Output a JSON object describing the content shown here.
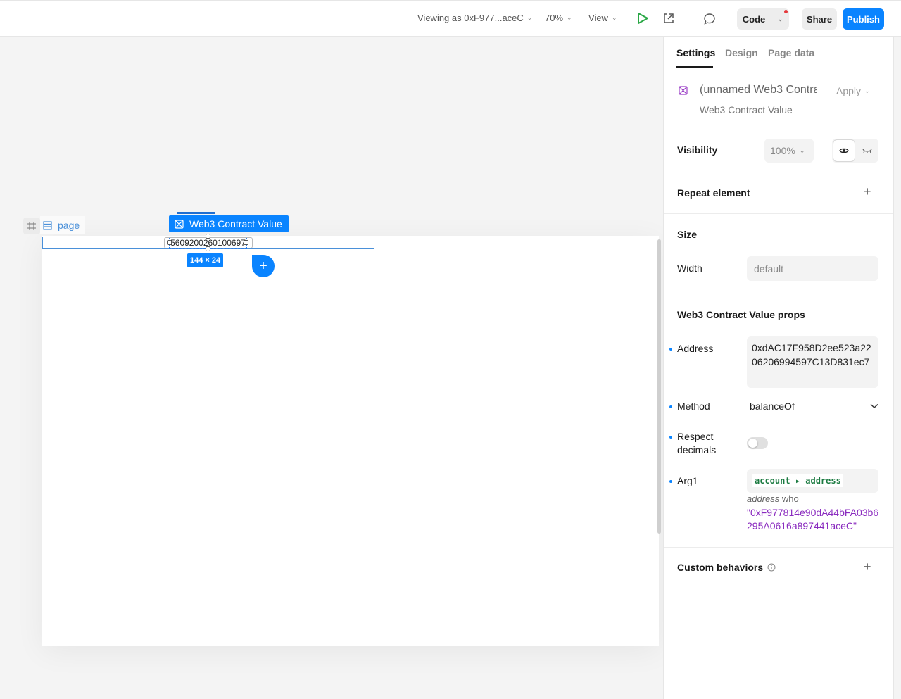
{
  "topbar": {
    "viewing_as": "Viewing as 0xF977...aceC",
    "zoom": "70%",
    "view": "View",
    "code": "Code",
    "share": "Share",
    "publish": "Publish"
  },
  "canvas": {
    "page_label": "page",
    "element_label": "Web3 Contract Value",
    "element_value": "5609200260100697",
    "size_badge": "144 × 24"
  },
  "panel": {
    "tabs": [
      "Settings",
      "Design",
      "Page data"
    ],
    "element_name": "(unnamed Web3 Contra",
    "apply": "Apply",
    "element_type": "Web3 Contract Value",
    "visibility_label": "Visibility",
    "visibility_value": "100%",
    "repeat_label": "Repeat element",
    "size_title": "Size",
    "width_label": "Width",
    "width_placeholder": "default",
    "props_title": "Web3 Contract Value props",
    "address_label": "Address",
    "address_value": "0xdAC17F958D2ee523a2206206994597C13D831ec7",
    "method_label": "Method",
    "method_value": "balanceOf",
    "respect_label_1": "Respect",
    "respect_label_2": "decimals",
    "arg1_label": "Arg1",
    "arg1_chip": "account ▸ address",
    "arg1_hint_italic": "address",
    "arg1_hint_rest": " who",
    "arg1_value": "\"0xF977814e90dA44bFA03b6295A0616a897441aceC\"",
    "custom_label": "Custom behaviors"
  },
  "colors": {
    "accent": "#0a84ff",
    "chip_green": "#1a7a40",
    "value_purple": "#8a2bbf",
    "play_green": "#29a745"
  }
}
